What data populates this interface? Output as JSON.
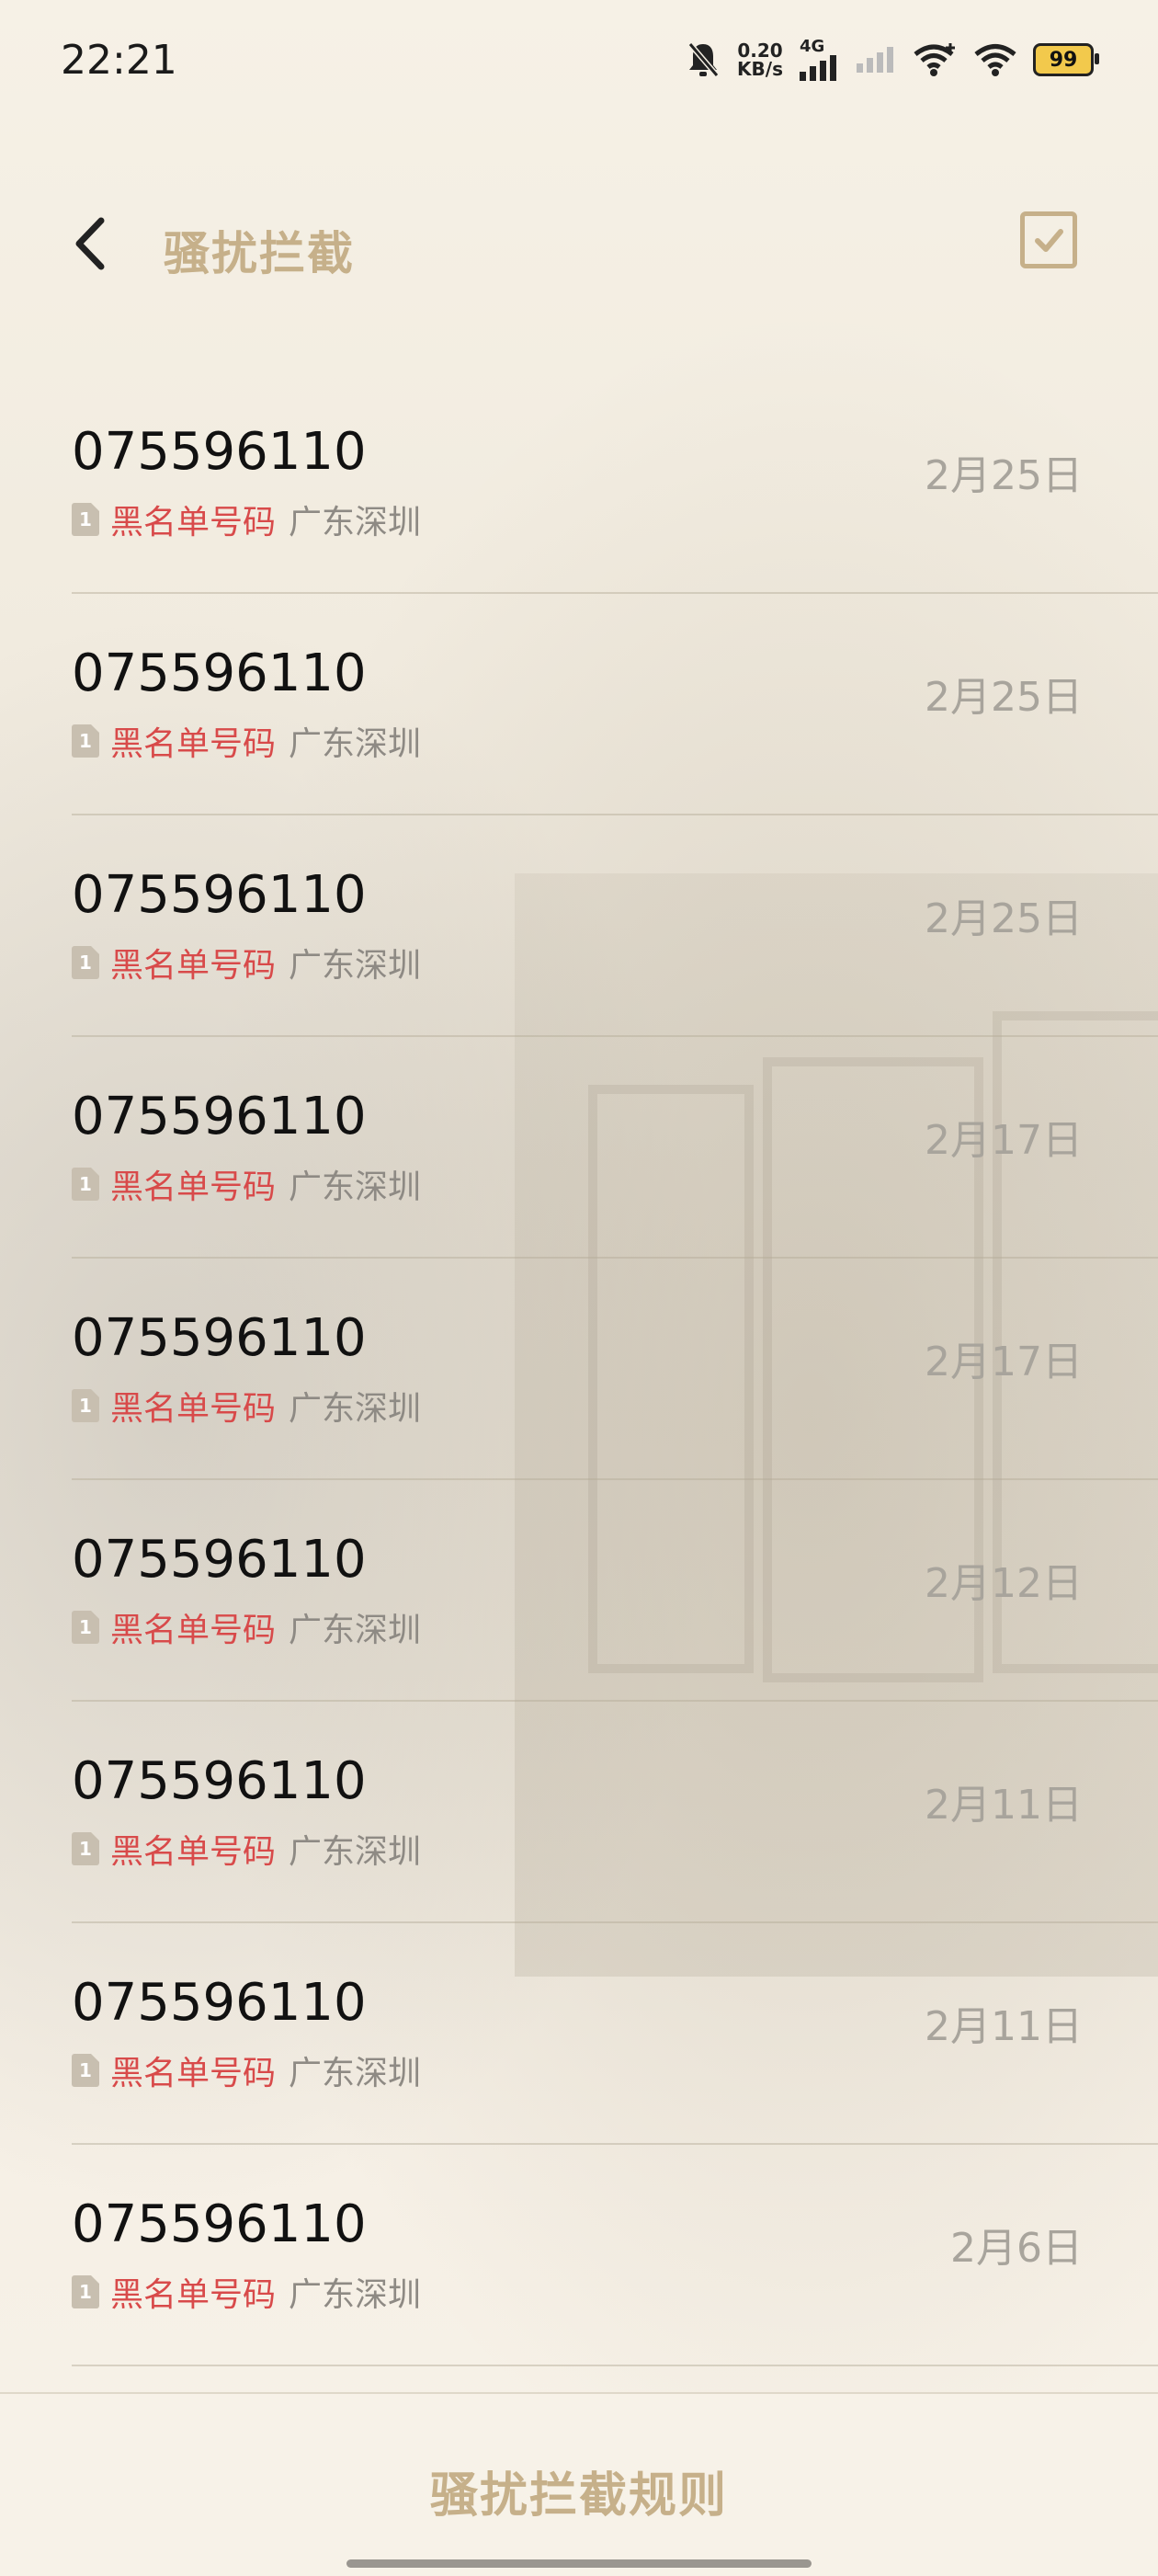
{
  "status_bar": {
    "time": "22:21",
    "speed_value": "0.20",
    "speed_unit": "KB/s",
    "network": "4G",
    "battery": "99"
  },
  "header": {
    "title": "骚扰拦截"
  },
  "calls": [
    {
      "number": "075596110",
      "tag": "黑名单号码",
      "location": "广东深圳",
      "date": "2月25日"
    },
    {
      "number": "075596110",
      "tag": "黑名单号码",
      "location": "广东深圳",
      "date": "2月25日"
    },
    {
      "number": "075596110",
      "tag": "黑名单号码",
      "location": "广东深圳",
      "date": "2月25日"
    },
    {
      "number": "075596110",
      "tag": "黑名单号码",
      "location": "广东深圳",
      "date": "2月17日"
    },
    {
      "number": "075596110",
      "tag": "黑名单号码",
      "location": "广东深圳",
      "date": "2月17日"
    },
    {
      "number": "075596110",
      "tag": "黑名单号码",
      "location": "广东深圳",
      "date": "2月12日"
    },
    {
      "number": "075596110",
      "tag": "黑名单号码",
      "location": "广东深圳",
      "date": "2月11日"
    },
    {
      "number": "075596110",
      "tag": "黑名单号码",
      "location": "广东深圳",
      "date": "2月11日"
    },
    {
      "number": "075596110",
      "tag": "黑名单号码",
      "location": "广东深圳",
      "date": "2月6日"
    }
  ],
  "sim_label": "1",
  "footer": {
    "rules_label": "骚扰拦截规则"
  },
  "colors": {
    "accent": "#c6b08a",
    "tag_red": "#d84a4a"
  }
}
